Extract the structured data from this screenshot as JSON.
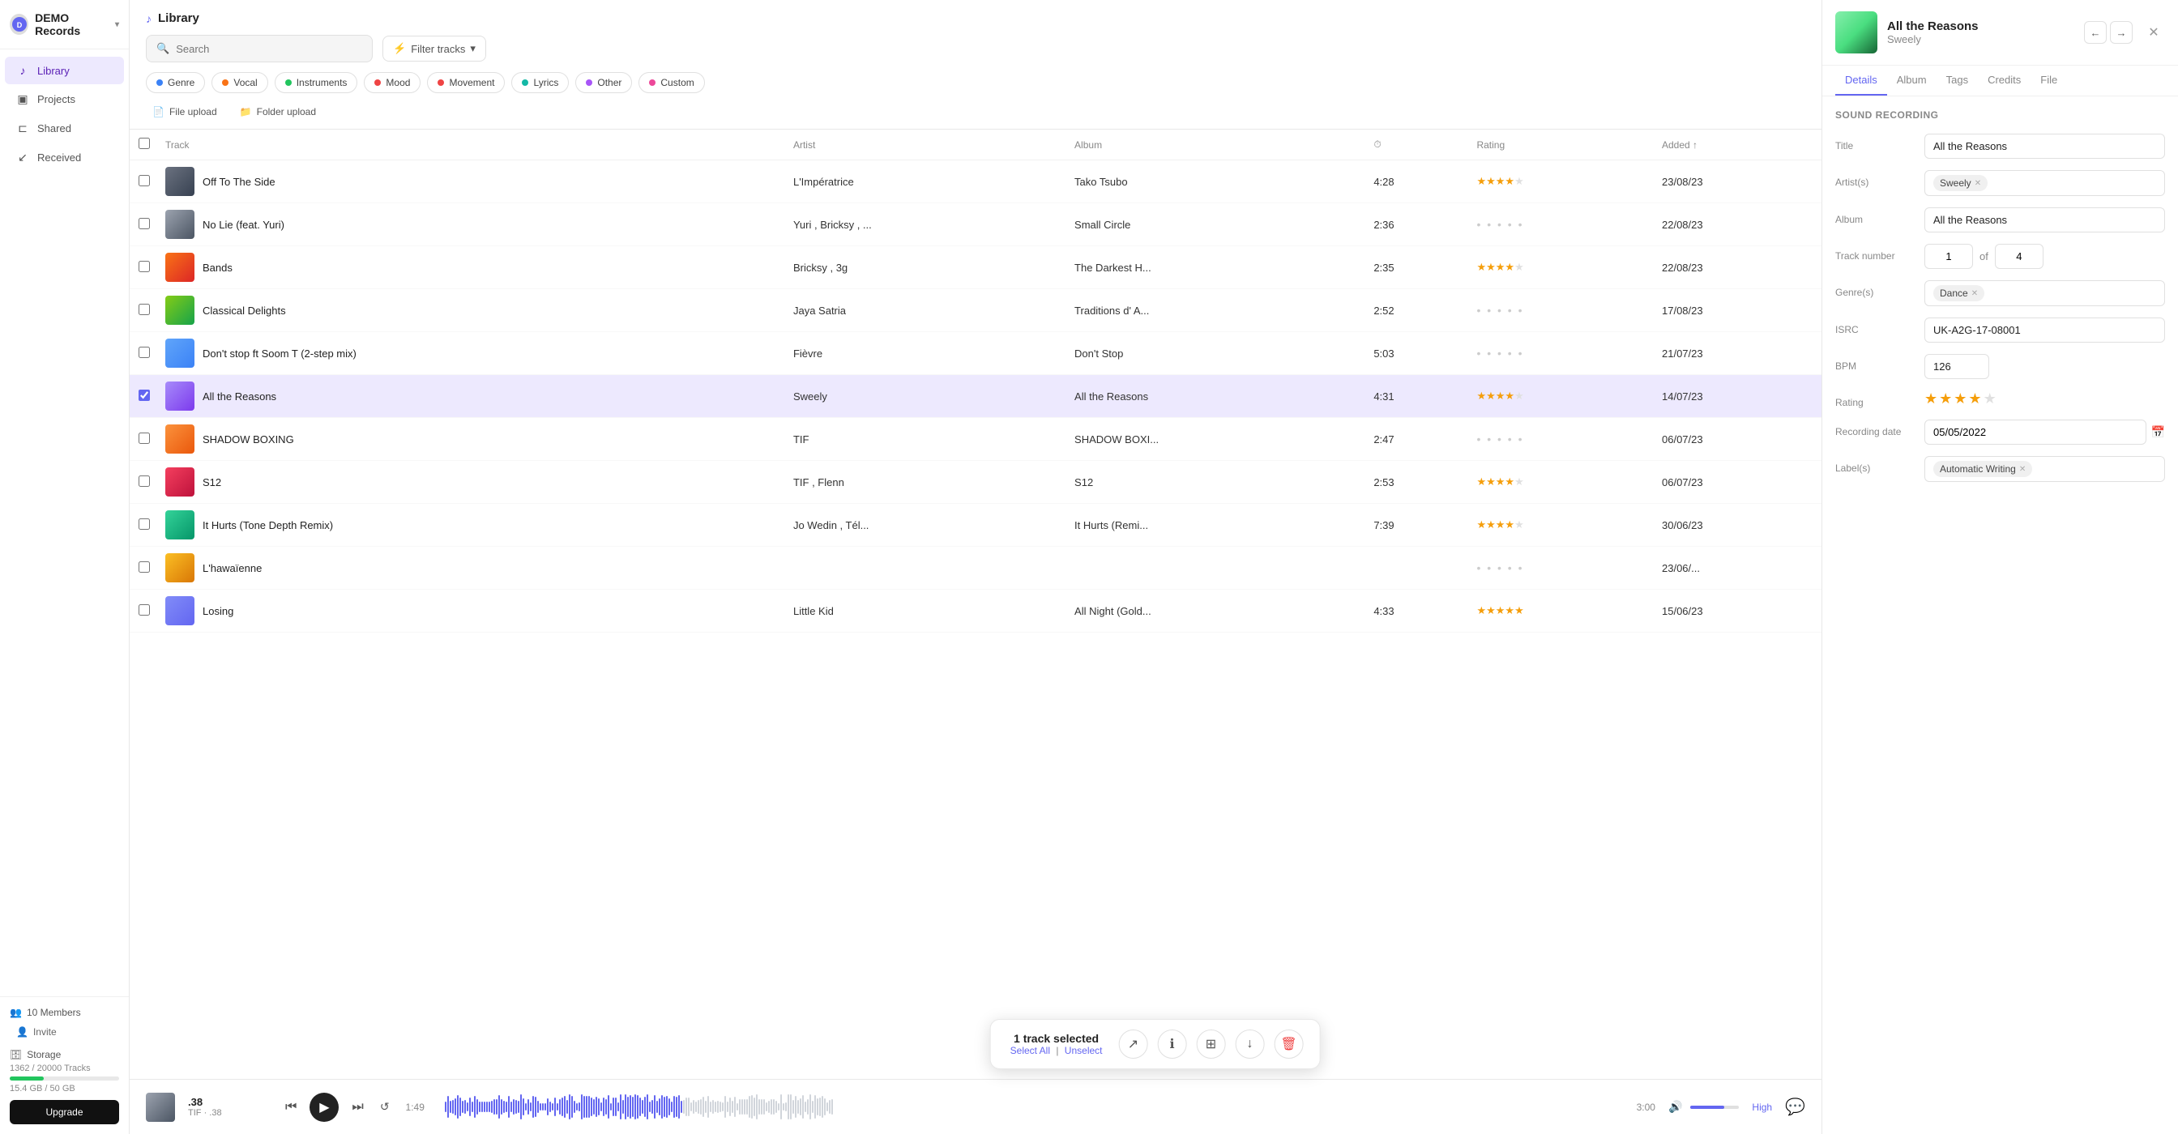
{
  "app": {
    "name": "DEMO Records",
    "chevron": "▾"
  },
  "sidebar": {
    "nav_items": [
      {
        "id": "library",
        "label": "Library",
        "icon": "♪",
        "active": true
      },
      {
        "id": "projects",
        "label": "Projects",
        "icon": "□",
        "active": false
      },
      {
        "id": "shared",
        "label": "Shared",
        "icon": "⊏",
        "active": false
      },
      {
        "id": "received",
        "label": "Received",
        "icon": "↙",
        "active": false
      }
    ],
    "members": {
      "count": "10 Members",
      "invite_label": "Invite"
    },
    "storage": {
      "title": "Storage",
      "tracks": "1362 / 20000 Tracks",
      "gb": "15.4 GB / 50 GB",
      "fill_pct": 31
    },
    "upgrade_label": "Upgrade"
  },
  "header": {
    "title": "Library",
    "title_icon": "♪",
    "search_placeholder": "Search",
    "filter_label": "Filter tracks",
    "tags": [
      {
        "id": "genre",
        "label": "Genre",
        "color": "#3b82f6"
      },
      {
        "id": "vocal",
        "label": "Vocal",
        "color": "#f97316"
      },
      {
        "id": "instruments",
        "label": "Instruments",
        "color": "#22c55e"
      },
      {
        "id": "mood",
        "label": "Mood",
        "color": "#ef4444"
      },
      {
        "id": "movement",
        "label": "Movement",
        "color": "#ef4444"
      },
      {
        "id": "lyrics",
        "label": "Lyrics",
        "color": "#14b8a6"
      },
      {
        "id": "other",
        "label": "Other",
        "color": "#a855f7"
      },
      {
        "id": "custom",
        "label": "Custom",
        "color": "#ec4899"
      }
    ],
    "upload": {
      "file_label": "File upload",
      "folder_label": "Folder upload"
    }
  },
  "table": {
    "columns": [
      {
        "id": "check",
        "label": ""
      },
      {
        "id": "track",
        "label": "Track"
      },
      {
        "id": "artist",
        "label": "Artist"
      },
      {
        "id": "album",
        "label": "Album"
      },
      {
        "id": "duration",
        "label": "⏱"
      },
      {
        "id": "rating",
        "label": "Rating"
      },
      {
        "id": "added",
        "label": "Added ↑"
      }
    ],
    "rows": [
      {
        "id": 1,
        "thumb_class": "thumb-1",
        "title": "Off To The Side",
        "artist": "L'Impératrice",
        "album": "Tako Tsubo",
        "duration": "4:28",
        "rating": 4,
        "added": "23/08/23",
        "selected": false
      },
      {
        "id": 2,
        "thumb_class": "thumb-2",
        "title": "No Lie (feat. Yuri)",
        "artist": "Yuri , Bricksy , ...",
        "album": "Small Circle",
        "duration": "2:36",
        "rating": 0,
        "added": "22/08/23",
        "selected": false
      },
      {
        "id": 3,
        "thumb_class": "thumb-3",
        "title": "Bands",
        "artist": "Bricksy , 3g",
        "album": "The Darkest H...",
        "duration": "2:35",
        "rating": 3.5,
        "added": "22/08/23",
        "selected": false
      },
      {
        "id": 4,
        "thumb_class": "thumb-4",
        "title": "Classical Delights",
        "artist": "Jaya Satria",
        "album": "Traditions d' A...",
        "duration": "2:52",
        "rating": 0,
        "added": "17/08/23",
        "selected": false
      },
      {
        "id": 5,
        "thumb_class": "thumb-5",
        "title": "Don't stop ft Soom T (2-step mix)",
        "artist": "Fièvre",
        "album": "Don't Stop",
        "duration": "5:03",
        "rating": 0,
        "added": "21/07/23",
        "selected": false
      },
      {
        "id": 6,
        "thumb_class": "thumb-6",
        "title": "All the Reasons",
        "artist": "Sweely",
        "album": "All the Reasons",
        "duration": "4:31",
        "rating": 3.5,
        "added": "14/07/23",
        "selected": true
      },
      {
        "id": 7,
        "thumb_class": "thumb-7",
        "title": "SHADOW BOXING",
        "artist": "TIF",
        "album": "SHADOW BOXI...",
        "duration": "2:47",
        "rating": 0,
        "added": "06/07/23",
        "selected": false
      },
      {
        "id": 8,
        "thumb_class": "thumb-8",
        "title": "S12",
        "artist": "TIF , Flenn",
        "album": "S12",
        "duration": "2:53",
        "rating": 3.5,
        "added": "06/07/23",
        "selected": false
      },
      {
        "id": 9,
        "thumb_class": "thumb-9",
        "title": "It Hurts (Tone Depth Remix)",
        "artist": "Jo Wedin , Tél...",
        "album": "It Hurts (Remi...",
        "duration": "7:39",
        "rating": 3.5,
        "added": "30/06/23",
        "selected": false
      },
      {
        "id": 10,
        "thumb_class": "thumb-10",
        "title": "L'hawaïenne",
        "artist": "",
        "album": "",
        "duration": "",
        "rating": 0,
        "added": "23/06/...",
        "selected": false
      },
      {
        "id": 11,
        "thumb_class": "thumb-11",
        "title": "Losing",
        "artist": "Little Kid",
        "album": "All Night (Gold...",
        "duration": "4:33",
        "rating": 5,
        "added": "15/06/23",
        "selected": false
      }
    ]
  },
  "selection_toolbar": {
    "count_label": "1 track selected",
    "select_all": "Select All",
    "unselect": "Unselect"
  },
  "player": {
    "track": ".38",
    "type": "TIF",
    "sub": ".38",
    "current_time": "1:49",
    "total_time": "3:00",
    "progress_pct": 61,
    "quality": "High"
  },
  "right_panel": {
    "title": "All the Reasons",
    "artist": "Sweely",
    "tabs": [
      "Details",
      "Album",
      "Tags",
      "Credits",
      "File"
    ],
    "active_tab": "Details",
    "section_title": "Sound recording",
    "fields": {
      "title_label": "Title",
      "title_value": "All the Reasons",
      "artist_label": "Artist(s)",
      "artist_value": "Sweely",
      "album_label": "Album",
      "album_value": "All the Reasons",
      "track_number_label": "Track number",
      "track_number": "1",
      "track_of": "of",
      "track_total": "4",
      "genre_label": "Genre(s)",
      "genre_value": "Dance",
      "isrc_label": "ISRC",
      "isrc_value": "UK-A2G-17-08001",
      "bpm_label": "BPM",
      "bpm_value": "126",
      "rating_label": "Rating",
      "rating_stars": 3.5,
      "recording_date_label": "Recording date",
      "recording_date_value": "05/05/2022",
      "label_label": "Label(s)",
      "label_value": "Automatic Writing"
    }
  }
}
